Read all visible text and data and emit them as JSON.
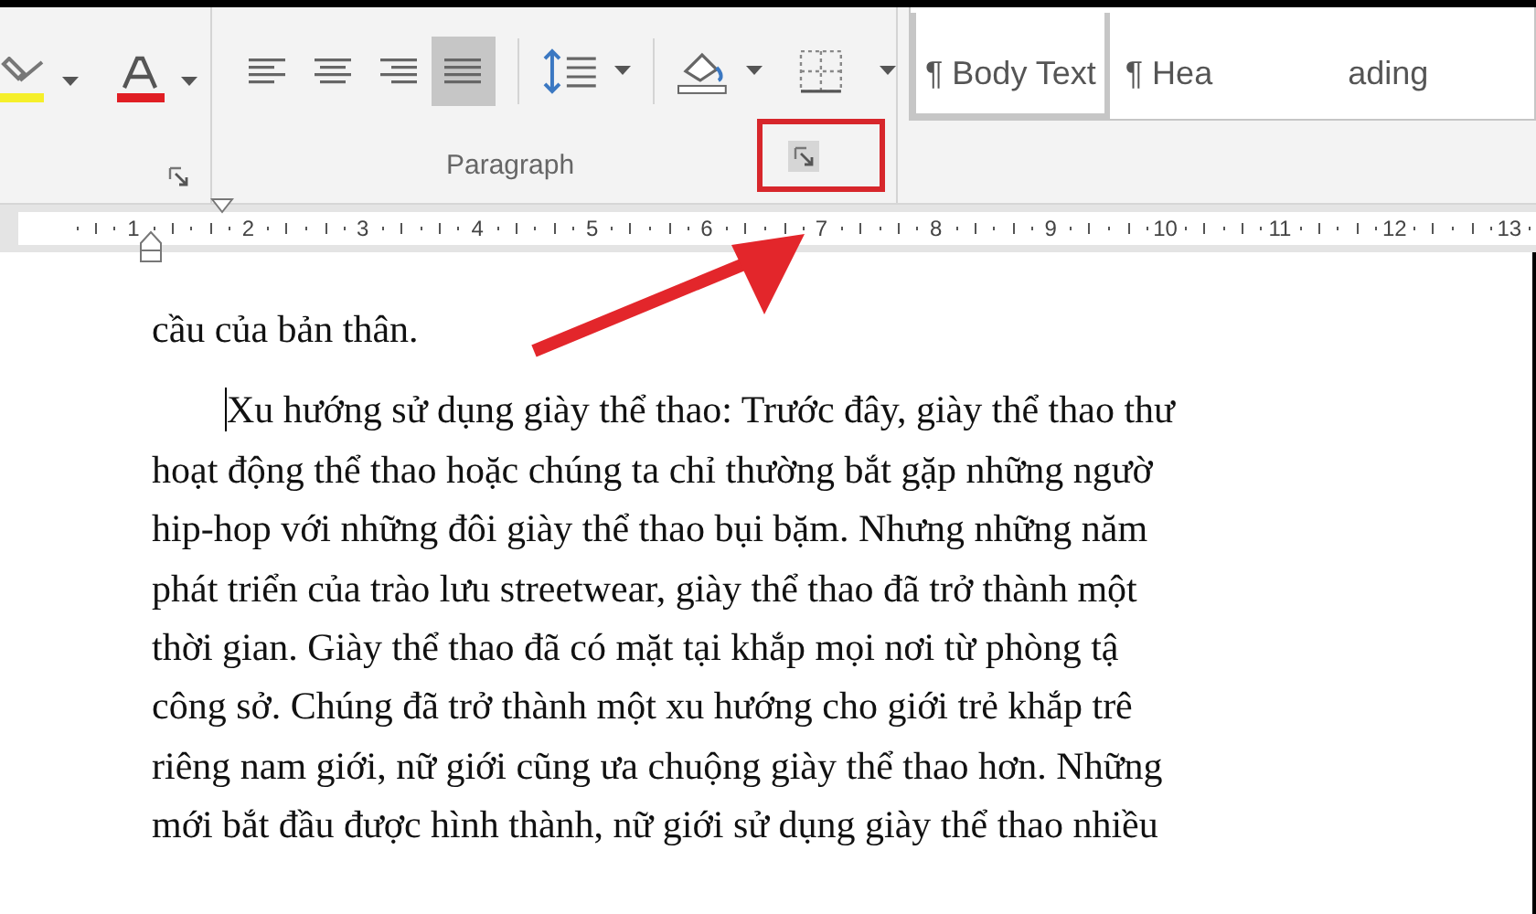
{
  "ribbon": {
    "alignment": [
      {
        "kind": "left",
        "selected": false
      },
      {
        "kind": "center",
        "selected": false
      },
      {
        "kind": "right",
        "selected": false
      },
      {
        "kind": "justify",
        "selected": true
      }
    ],
    "group_label": "Paragraph",
    "styles": [
      {
        "label": "¶ Body Text",
        "selected": true
      },
      {
        "label": "¶ Hea",
        "selected": false
      },
      {
        "label": "ading",
        "selected": false
      }
    ]
  },
  "ruler": {
    "numbers": [
      "1",
      "2",
      "3",
      "4",
      "5",
      "6",
      "7",
      "8",
      "9",
      "10",
      "11",
      "12",
      "13"
    ]
  },
  "document": {
    "paragraphs": [
      {
        "indent": false,
        "lines": [
          "cầu của bản thân."
        ]
      },
      {
        "indent": true,
        "cursor": true,
        "lines": [
          "Xu hướng sử dụng giày thể thao: Trước đây, giày thể thao thư",
          "hoạt động thể thao hoặc chúng ta chỉ thường bắt gặp những ngườ",
          "hip-hop với những đôi giày thể thao bụi bặm. Nhưng những năm",
          "phát triển của trào lưu streetwear, giày thể thao đã trở thành một",
          "thời gian. Giày thể thao đã có mặt tại khắp mọi nơi từ phòng tậ",
          "công sở. Chúng đã trở thành một xu hướng cho giới trẻ khắp trê",
          "riêng nam giới, nữ giới cũng ưa chuộng giày thể thao hơn. Những",
          "mới bắt đầu được hình thành, nữ giới sử dụng giày thể thao nhiều"
        ]
      }
    ]
  }
}
